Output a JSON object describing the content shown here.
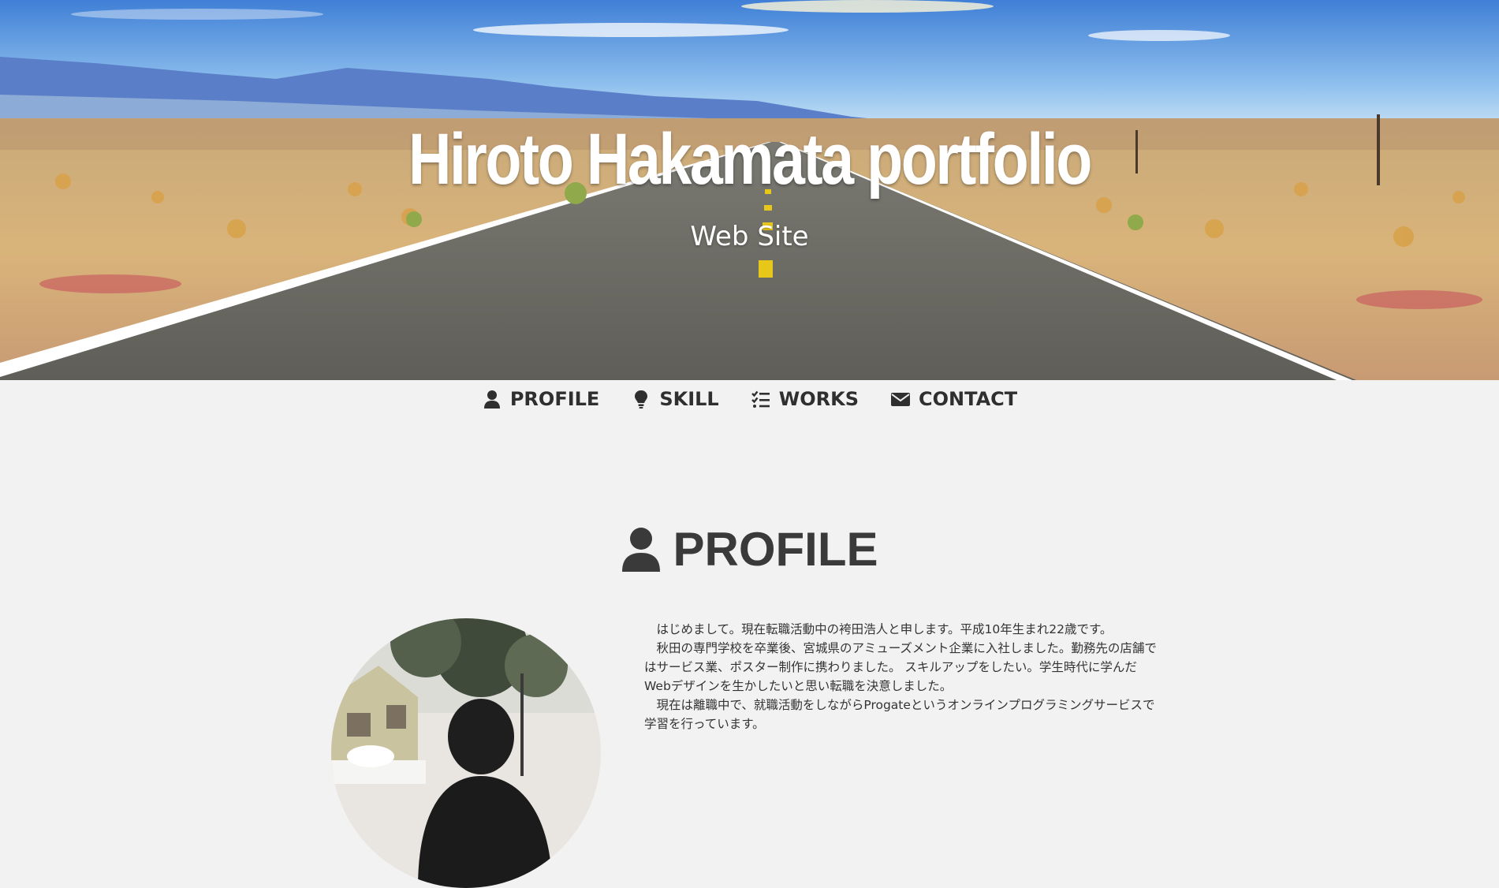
{
  "hero": {
    "title": "Hiroto Hakamata portfolio",
    "subtitle": "Web Site"
  },
  "nav": {
    "items": [
      {
        "label": "PROFILE",
        "icon": "user-icon"
      },
      {
        "label": "SKILL",
        "icon": "lightbulb-icon"
      },
      {
        "label": "WORKS",
        "icon": "tasks-icon"
      },
      {
        "label": "CONTACT",
        "icon": "envelope-icon"
      }
    ]
  },
  "profile": {
    "heading": "PROFILE",
    "heading_icon": "user-icon",
    "paragraphs": [
      "　はじめまして。現在転職活動中の袴田浩人と申します。平成10年生まれ22歳です。",
      "　秋田の専門学校を卒業後、宮城県のアミューズメント企業に入社しました。勤務先の店舗ではサービス業、ポスター制作に携わりました。 スキルアップをしたい。学生時代に学んだWebデザインを生かしたいと思い転職を決意しました。",
      "　現在は離職中で、就職活動をしながらProgateというオンラインプログラミングサービスで学習を行っています。"
    ]
  },
  "colors": {
    "page_background": "#f2f2f2",
    "nav_text": "#2f2f2f",
    "heading_text": "#3a3a3a",
    "hero_text": "#ffffff"
  }
}
